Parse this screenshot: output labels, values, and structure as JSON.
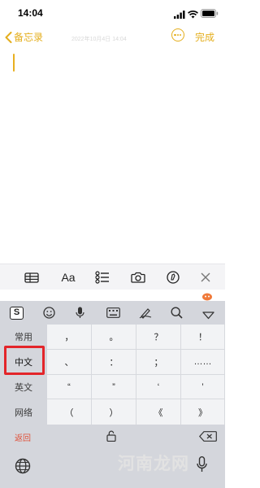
{
  "status": {
    "time": "14:04"
  },
  "nav": {
    "back_label": "备忘录",
    "meta_text": "2022年10月4日 14:04",
    "done_label": "完成"
  },
  "toolbar": {
    "icons": [
      "table-icon",
      "text-format-icon",
      "checklist-icon",
      "camera-icon",
      "markup-icon",
      "close-icon"
    ],
    "format_label": "Aa"
  },
  "keyboard": {
    "side_keys": [
      "常用",
      "中文",
      "英文",
      "网络"
    ],
    "grid": [
      [
        "，",
        "。",
        "？",
        "！"
      ],
      [
        "、",
        "：",
        "；",
        "……"
      ],
      [
        "“",
        "”",
        "‘",
        "’"
      ],
      [
        "（",
        "）",
        "《",
        "》"
      ]
    ],
    "return_label": "返回",
    "toolbar_icons": [
      "sogou-logo-icon",
      "emoji-icon",
      "microphone-icon",
      "keyboard-icon",
      "handwriting-icon",
      "search-icon",
      "collapse-icon"
    ]
  },
  "watermark": "河南龙网",
  "colors": {
    "accent": "#e4ae1d",
    "highlight": "#e3252a",
    "return": "#e1513a"
  }
}
